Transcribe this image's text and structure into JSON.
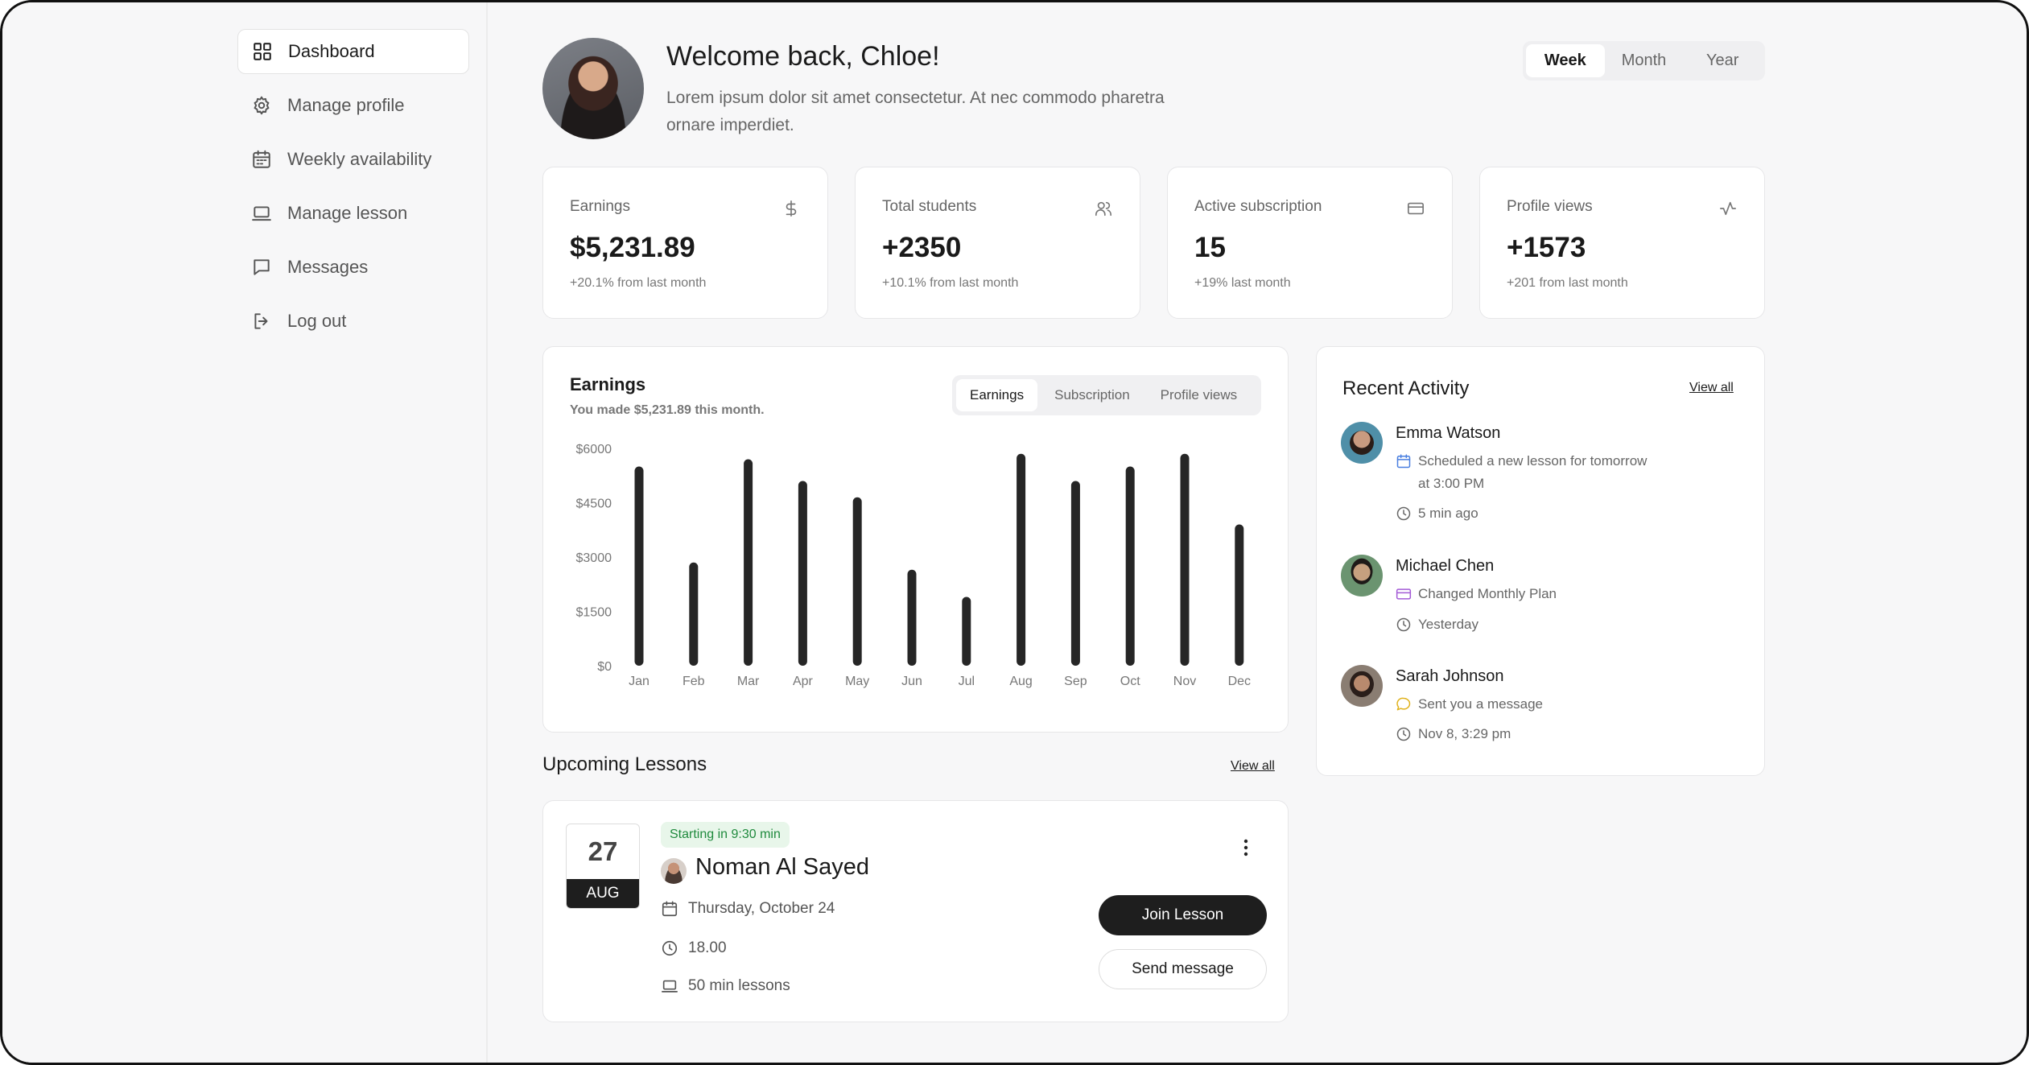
{
  "sidebar": {
    "items": [
      {
        "label": "Dashboard",
        "icon": "grid-icon",
        "active": true
      },
      {
        "label": "Manage profile",
        "icon": "gear-icon"
      },
      {
        "label": "Weekly availability",
        "icon": "calendar-icon"
      },
      {
        "label": "Manage lesson",
        "icon": "laptop-icon"
      },
      {
        "label": "Messages",
        "icon": "message-icon"
      },
      {
        "label": "Log out",
        "icon": "logout-icon"
      }
    ]
  },
  "header": {
    "welcome": "Welcome back, Chloe!",
    "subtitle": "Lorem ipsum dolor sit amet consectetur. At nec commodo pharetra ornare imperdiet.",
    "periods": [
      "Week",
      "Month",
      "Year"
    ],
    "active_period": "Week"
  },
  "stats": [
    {
      "label": "Earnings",
      "value": "$5,231.89",
      "change": "+20.1% from last month",
      "icon": "dollar-icon"
    },
    {
      "label": "Total students",
      "value": "+2350",
      "change": "+10.1% from last month",
      "icon": "users-icon"
    },
    {
      "label": "Active subscription",
      "value": "15",
      "change": "+19%  last month",
      "icon": "card-icon"
    },
    {
      "label": "Profile views",
      "value": "+1573",
      "change": "+201 from last month",
      "icon": "activity-icon"
    }
  ],
  "earnings_chart": {
    "title": "Earnings",
    "subtitle": "You made $5,231.89 this month.",
    "tabs": [
      "Earnings",
      "Subscription",
      "Profile views"
    ],
    "active_tab": "Earnings"
  },
  "chart_data": {
    "type": "bar",
    "title": "Earnings",
    "categories": [
      "Jan",
      "Feb",
      "Mar",
      "Apr",
      "May",
      "Jun",
      "Jul",
      "Aug",
      "Sep",
      "Oct",
      "Nov",
      "Dec"
    ],
    "values": [
      5500,
      2850,
      5700,
      5100,
      4650,
      2650,
      1900,
      5850,
      5100,
      5500,
      5850,
      3900
    ],
    "yticks": [
      "$6000",
      "$4500",
      "$3000",
      "$1500",
      "$0"
    ],
    "ylim": [
      0,
      6000
    ],
    "grid": false,
    "bar_color": "#262626"
  },
  "recent_activity": {
    "title": "Recent Activity",
    "view_all": "View all",
    "items": [
      {
        "name": "Emma Watson",
        "action": "Scheduled a new lesson for tomorrow",
        "action2": "at 3:00 PM",
        "time": "5 min ago",
        "action_color": "#4a7fe0"
      },
      {
        "name": "Michael Chen",
        "action": "Changed Monthly Plan",
        "time": "Yesterday",
        "action_color": "#a35ad6"
      },
      {
        "name": "Sarah Johnson",
        "action": "Sent you a message",
        "time": "Nov 8, 3:29 pm",
        "action_color": "#e0b21c"
      }
    ]
  },
  "upcoming": {
    "title": "Upcoming Lessons",
    "view_all": "View all",
    "lesson": {
      "day": "27",
      "month": "AUG",
      "badge": "Starting in 9:30 min",
      "student": "Noman Al Sayed",
      "date": "Thursday, October 24",
      "time": "18.00",
      "duration": "50 min lessons",
      "join_label": "Join Lesson",
      "message_label": "Send message"
    }
  }
}
